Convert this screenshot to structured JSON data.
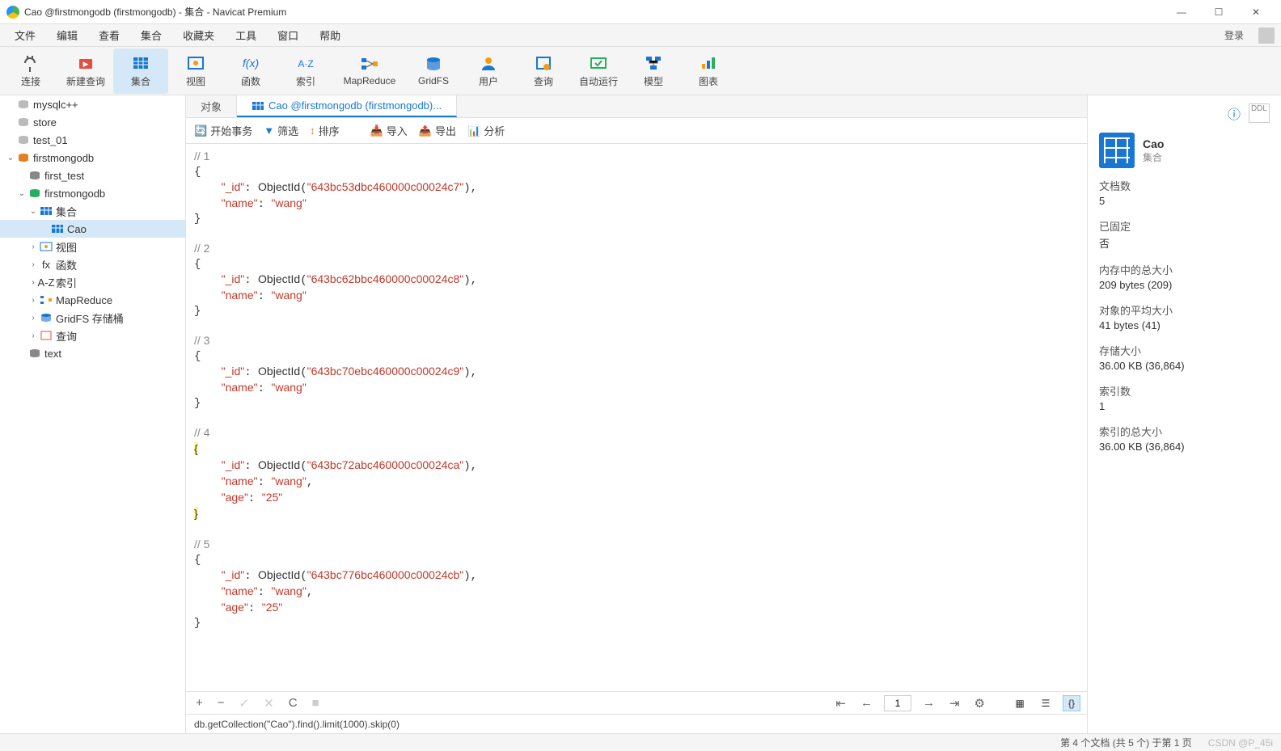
{
  "window": {
    "title": "Cao @firstmongodb (firstmongodb) - 集合 - Navicat Premium"
  },
  "menu": {
    "items": [
      "文件",
      "编辑",
      "查看",
      "集合",
      "收藏夹",
      "工具",
      "窗口",
      "帮助"
    ],
    "login": "登录"
  },
  "toolbar": [
    {
      "label": "连接",
      "icon": "plug"
    },
    {
      "label": "新建查询",
      "icon": "newquery"
    },
    {
      "label": "集合",
      "icon": "table",
      "active": true
    },
    {
      "label": "视图",
      "icon": "view"
    },
    {
      "label": "函数",
      "icon": "fx"
    },
    {
      "label": "索引",
      "icon": "az"
    },
    {
      "label": "MapReduce",
      "icon": "mapreduce",
      "wide": true
    },
    {
      "label": "GridFS",
      "icon": "gridfs"
    },
    {
      "label": "用户",
      "icon": "user"
    },
    {
      "label": "查询",
      "icon": "query"
    },
    {
      "label": "自动运行",
      "icon": "auto"
    },
    {
      "label": "模型",
      "icon": "model"
    },
    {
      "label": "图表",
      "icon": "chart"
    }
  ],
  "tree": [
    {
      "label": "mysqlc++",
      "icon": "db-off",
      "indent": 0
    },
    {
      "label": "store",
      "icon": "db-off",
      "indent": 0
    },
    {
      "label": "test_01",
      "icon": "db-off",
      "indent": 0
    },
    {
      "label": "firstmongodb",
      "icon": "db-on",
      "indent": 0,
      "toggle": "v",
      "color": "#e67e22"
    },
    {
      "label": "first_test",
      "icon": "db-gray",
      "indent": 1
    },
    {
      "label": "firstmongodb",
      "icon": "db-green",
      "indent": 1,
      "toggle": "v"
    },
    {
      "label": "集合",
      "icon": "table",
      "indent": 2,
      "toggle": "v"
    },
    {
      "label": "Cao",
      "icon": "table",
      "indent": 3,
      "selected": true
    },
    {
      "label": "视图",
      "icon": "view",
      "indent": 2,
      "toggle": ">"
    },
    {
      "label": "函数",
      "icon": "fx",
      "indent": 2,
      "toggle": ">"
    },
    {
      "label": "索引",
      "icon": "az",
      "indent": 2,
      "toggle": ">"
    },
    {
      "label": "MapReduce",
      "icon": "mapreduce",
      "indent": 2,
      "toggle": ">"
    },
    {
      "label": "GridFS 存储桶",
      "icon": "gridfs",
      "indent": 2,
      "toggle": ">"
    },
    {
      "label": "查询",
      "icon": "query",
      "indent": 2,
      "toggle": ">"
    },
    {
      "label": "text",
      "icon": "db-gray",
      "indent": 1
    }
  ],
  "tabs": [
    {
      "label": "对象",
      "active": false
    },
    {
      "label": "Cao @firstmongodb (firstmongodb)...",
      "active": true,
      "icon": "table"
    }
  ],
  "subToolbar": {
    "start_tx": "开始事务",
    "filter": "筛选",
    "sort": "排序",
    "import": "导入",
    "export": "导出",
    "analyze": "分析"
  },
  "documents": [
    {
      "n": 1,
      "id": "643bc53dbc460000c00024c7",
      "fields": [
        {
          "k": "name",
          "v": "wang"
        }
      ]
    },
    {
      "n": 2,
      "id": "643bc62bbc460000c00024c8",
      "fields": [
        {
          "k": "name",
          "v": "wang"
        }
      ]
    },
    {
      "n": 3,
      "id": "643bc70ebc460000c00024c9",
      "fields": [
        {
          "k": "name",
          "v": "wang"
        }
      ]
    },
    {
      "n": 4,
      "id": "643bc72abc460000c00024ca",
      "fields": [
        {
          "k": "name",
          "v": "wang"
        },
        {
          "k": "age",
          "v": "25"
        }
      ],
      "highlight": true
    },
    {
      "n": 5,
      "id": "643bc776bc460000c00024cb",
      "fields": [
        {
          "k": "name",
          "v": "wang"
        },
        {
          "k": "age",
          "v": "25"
        }
      ]
    }
  ],
  "bottomBar": {
    "page": "1"
  },
  "queryLine": "db.getCollection(\"Cao\").find().limit(1000).skip(0)",
  "rightPanel": {
    "name": "Cao",
    "type": "集合",
    "stats": [
      {
        "label": "文档数",
        "value": "5"
      },
      {
        "label": "已固定",
        "value": "否"
      },
      {
        "label": "内存中的总大小",
        "value": "209 bytes (209)"
      },
      {
        "label": "对象的平均大小",
        "value": "41 bytes (41)"
      },
      {
        "label": "存储大小",
        "value": "36.00 KB (36,864)"
      },
      {
        "label": "索引数",
        "value": "1"
      },
      {
        "label": "索引的总大小",
        "value": "36.00 KB (36,864)"
      }
    ]
  },
  "statusBar": {
    "left": "第 4 个文档 (共 5 个) 于第 1 页",
    "right": "CSDN @P_45i"
  }
}
